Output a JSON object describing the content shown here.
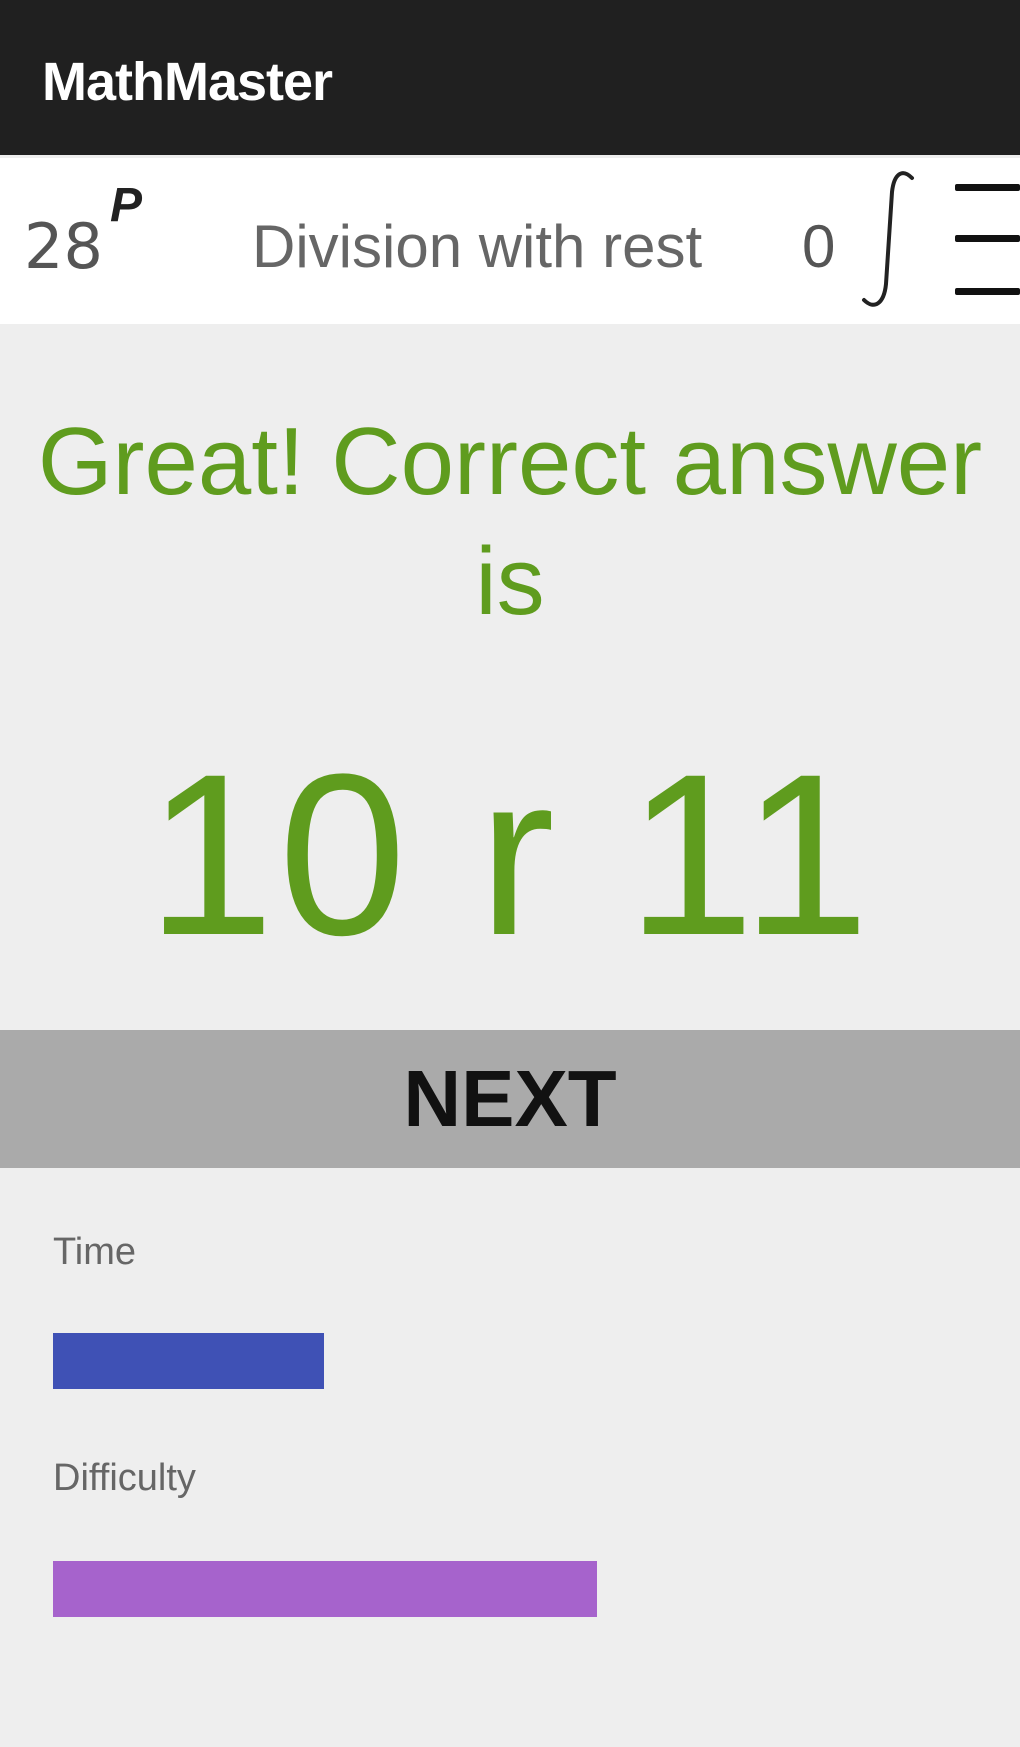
{
  "app": {
    "title": "MathMaster"
  },
  "header": {
    "points_value": "28",
    "points_icon": "P",
    "topic": "Division with rest",
    "integral_value": "0",
    "integral_icon": "integral-icon",
    "menu_icon": "hamburger-menu-icon"
  },
  "feedback": {
    "message": "Great! Correct answer is",
    "answer": "10 r 11"
  },
  "actions": {
    "next_label": "NEXT"
  },
  "stats": {
    "time": {
      "label": "Time",
      "fraction": 0.296,
      "color": "#3f51b5"
    },
    "difficulty": {
      "label": "Difficulty",
      "fraction": 0.595,
      "color": "#a663cc"
    }
  },
  "colors": {
    "app_bar": "#202020",
    "success": "#5f9c1e",
    "next_button": "#aaaaaa",
    "background": "#eeeeee"
  }
}
